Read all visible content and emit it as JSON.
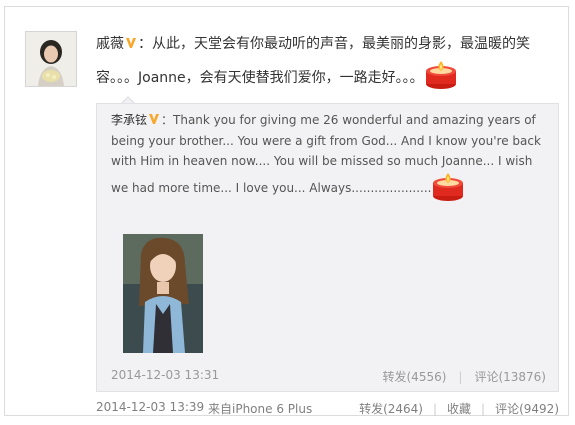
{
  "post": {
    "author_name": "戚薇",
    "text": "：从此，天堂会有你最动听的声音，最美丽的身影，最温暖的笑容。。。Joanne，会有天使替我们爱你，一路走好。。。",
    "time": "2014-12-03 13:39",
    "source": "来自iPhone 6 Plus",
    "actions": {
      "repost": "转发(2464)",
      "favorite": "收藏",
      "comment": "评论(9492)"
    }
  },
  "quoted": {
    "author_name": "李承铉",
    "text": "：Thank you for giving me 26 wonderful and amazing years of being your brother... You were a gift from God... And I know you're back with Him in heaven now.... You will be missed so much Joanne... I wish we had more time... I love you... Always.....................",
    "time": "2014-12-03 13:31",
    "actions": {
      "repost": "转发(4556)",
      "comment": "评论(13876)"
    }
  },
  "icons": {
    "verified": "verified-v-icon",
    "candle": "candle-emoji-icon"
  },
  "colors": {
    "name": "#eb7350",
    "quote_bg": "#f2f2f5",
    "meta_text": "#999999",
    "verified_badge": "#f7a82c",
    "candle": "#e02a1f"
  }
}
